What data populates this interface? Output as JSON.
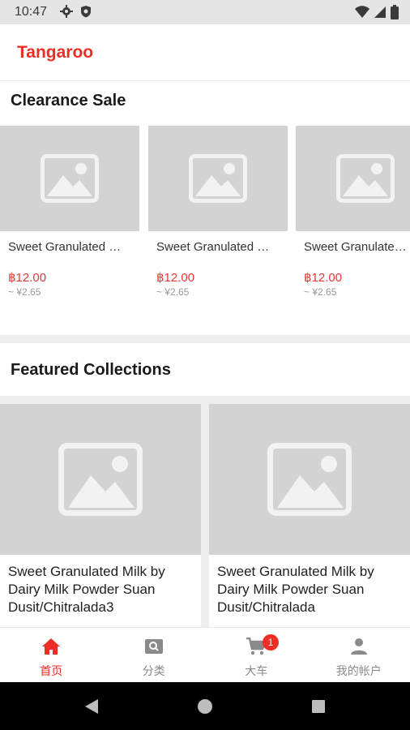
{
  "status_bar": {
    "time": "10:47",
    "left_icons": [
      "gear-icon",
      "shield-icon"
    ],
    "right_icons": [
      "wifi-icon",
      "signal-icon",
      "battery-icon"
    ]
  },
  "header": {
    "brand": "Tangaroo",
    "brand_color": "#ee2d24"
  },
  "clearance": {
    "title": "Clearance Sale",
    "items": [
      {
        "name": "Sweet Granulated Milk by Dairy Milk Powder Suan Dusit/Chitralada",
        "price": "฿12.00",
        "approx": "~ ¥2.65"
      },
      {
        "name": "Sweet Granulated Milk by Dairy Milk Powder Suan Dusit/Chitralada",
        "price": "฿12.00",
        "approx": "~ ¥2.65"
      },
      {
        "name": "Sweet Granulated Milk by Dairy Milk Powder Suan Dusit/Chitralada",
        "price": "฿12.00",
        "approx": "~ ¥2.65"
      }
    ]
  },
  "featured": {
    "title": "Featured Collections",
    "items": [
      {
        "name": "Sweet Granulated Milk by Dairy Milk Powder Suan Dusit/Chitralada3"
      },
      {
        "name": "Sweet Granulated Milk by Dairy Milk Powder Suan Dusit/Chitralada"
      }
    ]
  },
  "bottom_nav": {
    "items": [
      {
        "label": "首页",
        "icon": "home-icon",
        "active": true
      },
      {
        "label": "分类",
        "icon": "search-category-icon",
        "active": false
      },
      {
        "label": "大车",
        "icon": "cart-icon",
        "active": false,
        "badge": "1"
      },
      {
        "label": "我的帐户",
        "icon": "account-icon",
        "active": false
      }
    ]
  },
  "android_nav": [
    "back-icon",
    "home-circle-icon",
    "recents-icon"
  ],
  "colors": {
    "accent": "#ee2d24",
    "price": "#e53935",
    "placeholder_bg": "#d3d3d3"
  }
}
